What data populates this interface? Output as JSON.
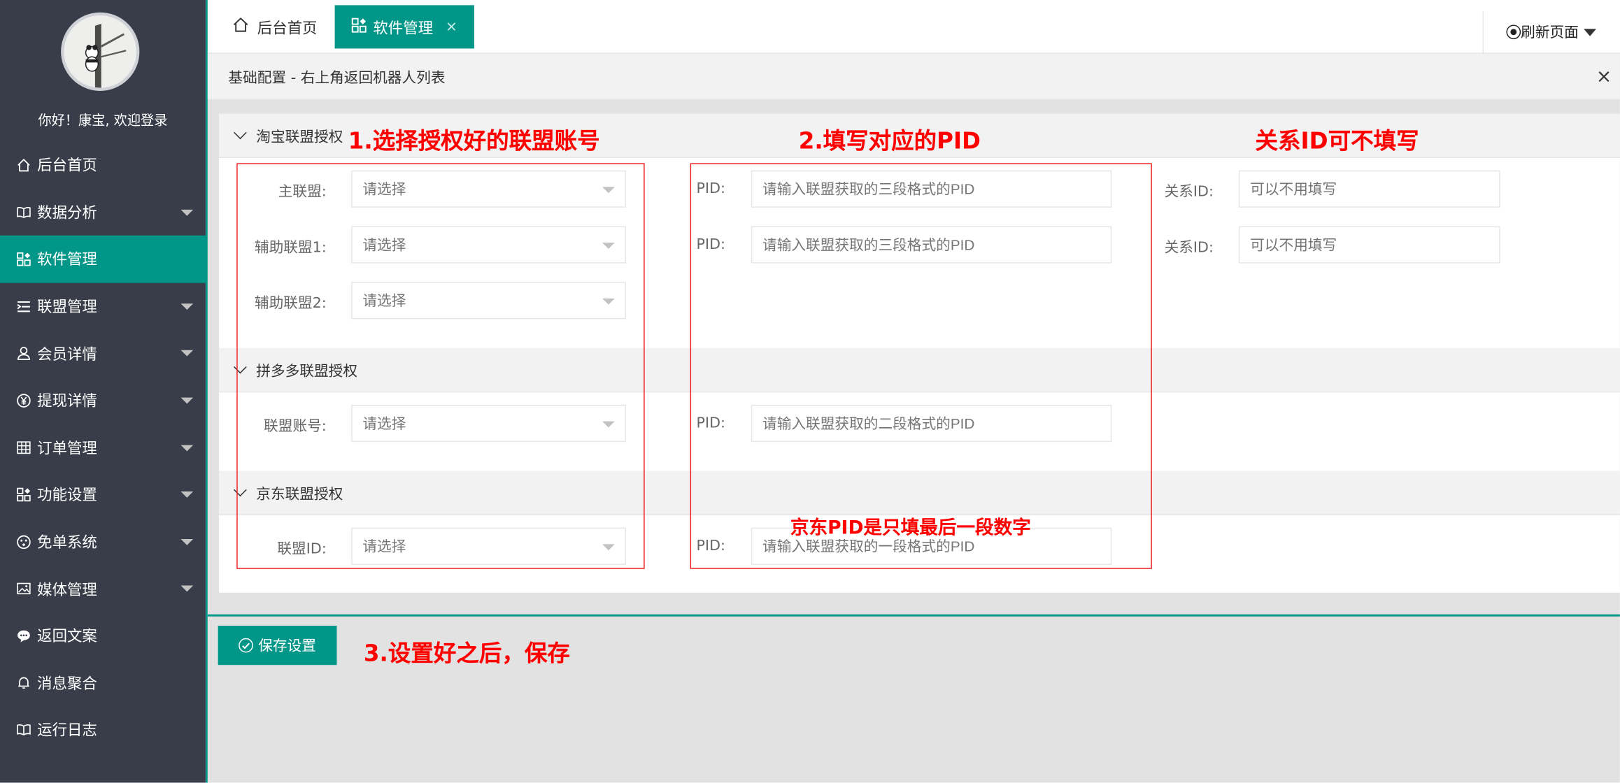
{
  "sidebar": {
    "welcome": "你好！康宝, 欢迎登录",
    "items": [
      {
        "label": "后台首页",
        "icon": "home-icon",
        "has_caret": false,
        "active": false
      },
      {
        "label": "数据分析",
        "icon": "book-icon",
        "has_caret": true,
        "active": false
      },
      {
        "label": "软件管理",
        "icon": "apps-icon",
        "has_caret": false,
        "active": true
      },
      {
        "label": "联盟管理",
        "icon": "list-icon",
        "has_caret": true,
        "active": false
      },
      {
        "label": "会员详情",
        "icon": "user-icon",
        "has_caret": true,
        "active": false
      },
      {
        "label": "提现详情",
        "icon": "yen-icon",
        "has_caret": true,
        "active": false
      },
      {
        "label": "订单管理",
        "icon": "grid-icon",
        "has_caret": true,
        "active": false
      },
      {
        "label": "功能设置",
        "icon": "apps-icon",
        "has_caret": true,
        "active": false
      },
      {
        "label": "免单系统",
        "icon": "face-icon",
        "has_caret": true,
        "active": false
      },
      {
        "label": "媒体管理",
        "icon": "picture-icon",
        "has_caret": true,
        "active": false
      },
      {
        "label": "返回文案",
        "icon": "chat-icon",
        "has_caret": false,
        "active": false
      },
      {
        "label": "消息聚合",
        "icon": "bell-icon",
        "has_caret": false,
        "active": false
      },
      {
        "label": "运行日志",
        "icon": "book-icon",
        "has_caret": false,
        "active": false
      }
    ]
  },
  "tabs": {
    "home": "后台首页",
    "active": "软件管理",
    "close": "×",
    "refresh": "刷新页面"
  },
  "page": {
    "title": "基础配置 - 右上角返回机器人列表",
    "close": "×"
  },
  "sections": {
    "taobao": "淘宝联盟授权",
    "pdd": "拼多多联盟授权",
    "jd": "京东联盟授权"
  },
  "form": {
    "select_placeholder": "请选择",
    "relation_label": "关系ID:",
    "relation_placeholder": "可以不用填写",
    "pid_label": "PID:",
    "rows": {
      "main_union": "主联盟:",
      "aux_union_1": "辅助联盟1:",
      "aux_union_2": "辅助联盟2:",
      "pdd_account": "联盟账号:",
      "jd_id": "联盟ID:"
    },
    "pid_placeholders": {
      "three_seg": "请输入联盟获取的三段格式的PID",
      "two_seg": "请输入联盟获取的二段格式的PID",
      "one_seg": "请输入联盟获取的一段格式的PID"
    }
  },
  "save_button": "保存设置",
  "annotations": {
    "step1": "1.选择授权好的联盟账号",
    "step2": "2.填写对应的PID",
    "relation_note": "关系ID可不填写",
    "jd_note": "京东PID是只填最后一段数字",
    "step3": "3.设置好之后，保存"
  },
  "colors": {
    "sidebar_bg": "#393d49",
    "accent": "#009688",
    "annotation": "#ff0000"
  }
}
